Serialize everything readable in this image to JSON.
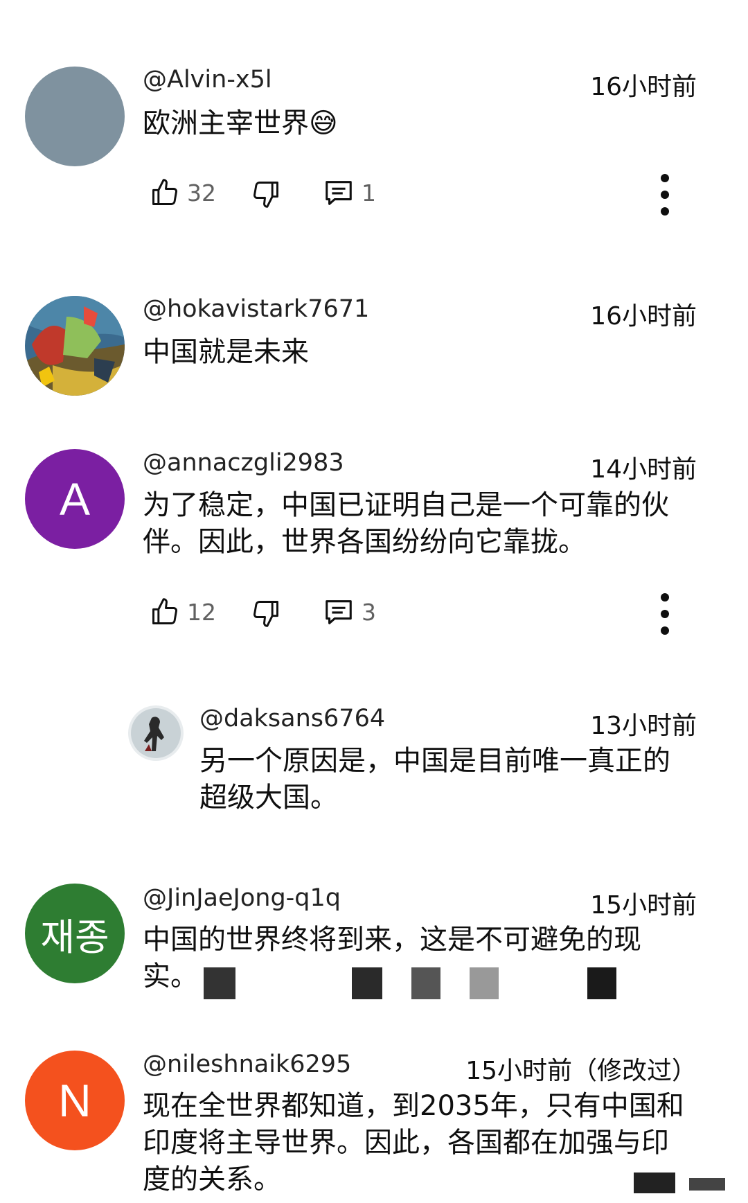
{
  "comments": [
    {
      "handle": "@Alvin-x5l",
      "time": "16小时前",
      "text": "欧洲主宰世界",
      "emoji": "😅",
      "avatar_color": "#7f929f",
      "likes": "32",
      "replies": "1"
    },
    {
      "handle": "@hokavistark7671",
      "time": "16小时前",
      "text": "中国就是未来"
    },
    {
      "handle": "@annaczgli2983",
      "time": "14小时前",
      "avatar_letter": "A",
      "avatar_color": "#7b1fa2",
      "text_lines": [
        "为了稳定，中国已证明自己是一个可靠的伙",
        "伴。因此，世界各国纷纷向它靠拢。"
      ],
      "likes": "12",
      "replies": "3"
    },
    {
      "handle": "@daksans6764",
      "time": "13小时前",
      "text_lines": [
        "另一个原因是，中国是目前唯一真正的",
        "超级大国。"
      ]
    },
    {
      "handle": "@JinJaeJong-q1q",
      "time": "15小时前",
      "avatar_letter": "재종",
      "avatar_color": "#2e7d32",
      "text_lines": [
        "中国的世界终将到来，这是不可避免的现",
        "实。"
      ]
    },
    {
      "handle": "@nileshnaik6295",
      "time": "15小时前（修改过）",
      "avatar_letter": "N",
      "avatar_color": "#f4511e",
      "text_lines": [
        "现在全世界都知道，到2035年，只有中国和",
        "印度将主导世界。因此，各国都在加强与印",
        "度的关系。"
      ]
    }
  ]
}
